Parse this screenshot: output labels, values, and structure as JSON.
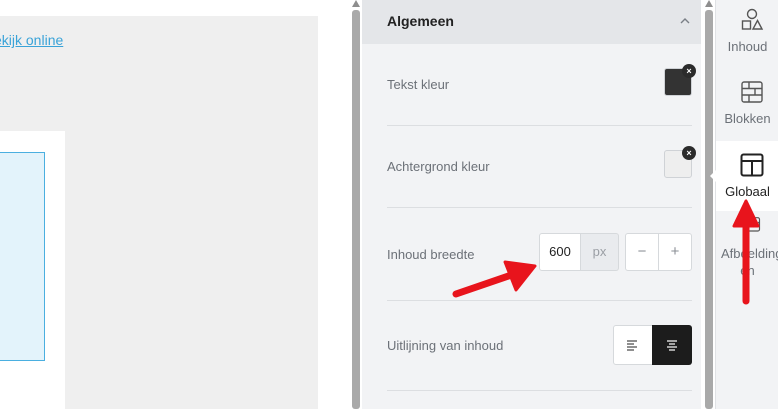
{
  "canvas": {
    "view_online_link": "ekijk online"
  },
  "panel": {
    "section_title": "Algemeen",
    "rows": {
      "text_color": {
        "label": "Tekst kleur",
        "value": "#333333"
      },
      "background_color": {
        "label": "Achtergrond kleur",
        "value": "#eeeeee"
      },
      "content_width": {
        "label": "Inhoud breedte",
        "value": "600",
        "unit": "px",
        "minus": "−",
        "plus": "+"
      },
      "content_alignment": {
        "label": "Uitlijning van inhoud",
        "selected": "center"
      }
    },
    "clear_glyph": "×"
  },
  "sidebar": {
    "items": [
      {
        "label": "Inhoud",
        "icon": "shapes-icon"
      },
      {
        "label": "Blokken",
        "icon": "grid-icon"
      },
      {
        "label": "Globaal",
        "icon": "layout-icon",
        "active": true
      },
      {
        "label": "Afbeelding",
        "label2": "en",
        "icon": "image-icon"
      }
    ]
  },
  "colors": {
    "accent_link": "#3aa3d8",
    "annotation_arrow": "#e8141c",
    "active_toggle": "#1c1c1c"
  }
}
